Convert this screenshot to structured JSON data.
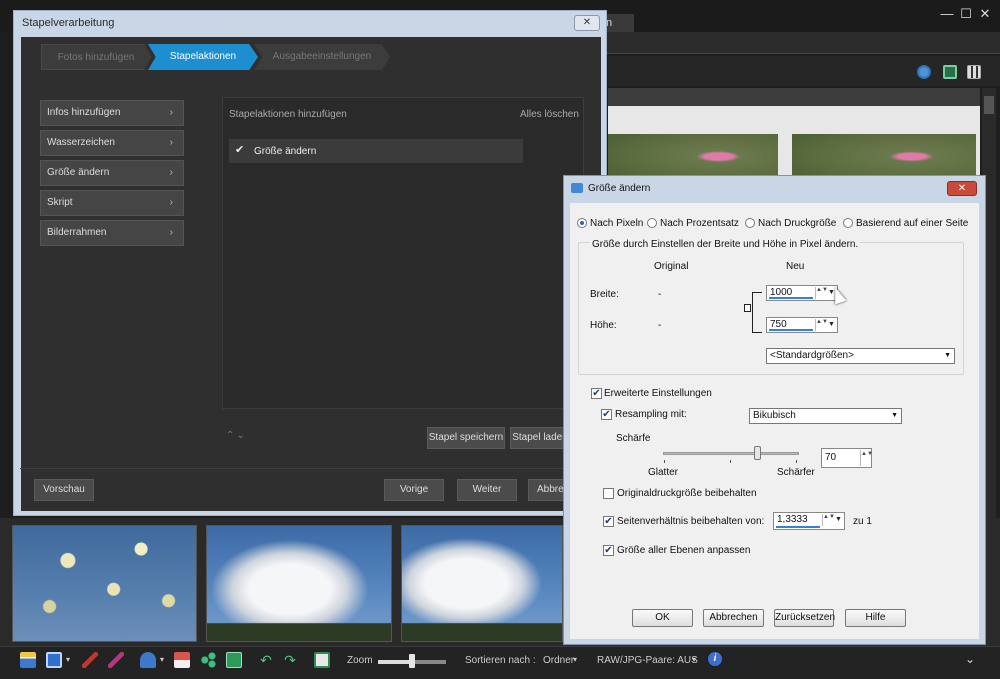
{
  "app": {
    "tab_fragment": "n",
    "window_controls": {
      "minimize": "—",
      "maximize": "☐",
      "close": "✕"
    },
    "toolbar_icons": [
      "globe-icon",
      "image-view-icon",
      "grid-view-icon"
    ]
  },
  "batch_window": {
    "title": "Stapelverarbeitung",
    "close": "✕",
    "steps": [
      "Fotos hinzufügen",
      "Stapelaktionen",
      "Ausgabeeinstellungen"
    ],
    "active_step": "Stapelaktionen",
    "side_actions": [
      "Infos hinzufügen",
      "Wasserzeichen",
      "Größe ändern",
      "Skript",
      "Bilderrahmen"
    ],
    "chevron": "›",
    "panel_title": "Stapelaktionen hinzufügen",
    "clear_all": "Alles löschen",
    "actions": [
      {
        "label": "Größe ändern",
        "checked": true
      }
    ],
    "checkmark": "✔",
    "updown": "⌃⌄",
    "save_button": "Stapel speichern",
    "load_button": "Stapel laden",
    "preview_button": "Vorschau",
    "back_button": "Vorige",
    "next_button": "Weiter",
    "cancel_button": "Abbrechen"
  },
  "resize_dialog": {
    "title": "Größe ändern",
    "close": "✕",
    "modes": [
      "Nach Pixeln",
      "Nach Prozentsatz",
      "Nach Druckgröße",
      "Basierend auf einer Seite"
    ],
    "selected_mode": "Nach Pixeln",
    "group_label": "Größe durch Einstellen der Breite und Höhe in Pixel ändern.",
    "col_original": "Original",
    "col_new": "Neu",
    "width_label": "Breite:",
    "height_label": "Höhe:",
    "width_original": "-",
    "height_original": "-",
    "width_new": "1000",
    "height_new": "750",
    "preset_select": "<Standardgrößen>",
    "advanced_label": "Erweiterte Einstellungen",
    "advanced_checked": true,
    "resample_label": "Resampling mit:",
    "resample_checked": true,
    "resample_method": "Bikubisch",
    "sharpness_label": "Schärfe",
    "sharpness_min": "Glatter",
    "sharpness_max": "Schärfer",
    "sharpness_value": "70",
    "keep_print_size_label": "Originaldruckgröße beibehalten",
    "keep_print_size_checked": false,
    "aspect_label": "Seitenverhältnis beibehalten von:",
    "aspect_checked": true,
    "aspect_value": "1,3333",
    "aspect_suffix": "zu 1",
    "all_layers_label": "Größe aller Ebenen anpassen",
    "all_layers_checked": true,
    "ok_button": "OK",
    "cancel_button": "Abbrechen",
    "reset_button": "Zurücksetzen",
    "help_button": "Hilfe",
    "spin_arrows": "▲▼",
    "drop_caret": "▼"
  },
  "bottom_bar": {
    "zoom_label": "Zoom",
    "zoom_level": 0.5,
    "sort_label": "Sortieren nach :",
    "sort_value": "Ordner",
    "raw_label": "RAW/JPG-Paare: AUS",
    "caret": "▾",
    "info": "i",
    "expand": "⌄"
  }
}
